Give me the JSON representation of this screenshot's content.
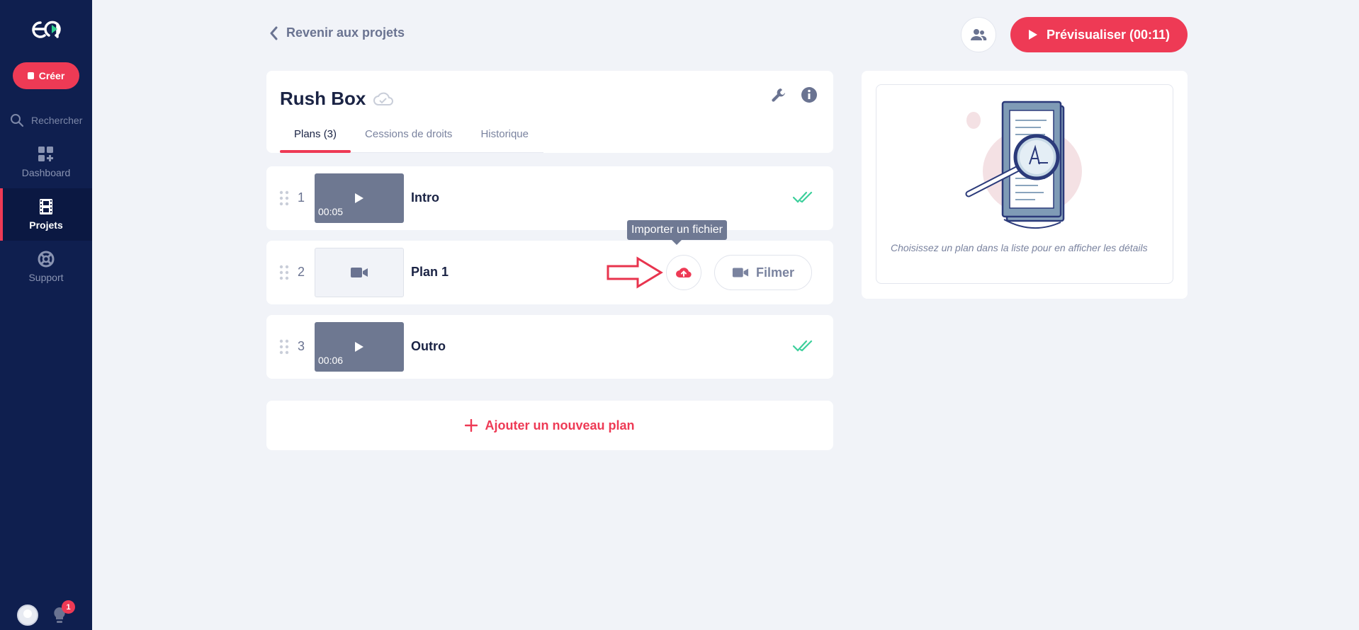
{
  "sidebar": {
    "create_label": "Créer",
    "search_label": "Rechercher",
    "items": [
      {
        "label": "Dashboard",
        "icon": "dashboard-icon"
      },
      {
        "label": "Projets",
        "icon": "film-icon",
        "active": true
      },
      {
        "label": "Support",
        "icon": "lifebuoy-icon"
      }
    ],
    "notification_count": "1"
  },
  "header": {
    "back_label": "Revenir aux projets",
    "preview_label": "Prévisualiser (00:11)"
  },
  "project": {
    "title": "Rush Box",
    "tabs": [
      {
        "label": "Plans (3)",
        "active": true
      },
      {
        "label": "Cessions de droits"
      },
      {
        "label": "Historique"
      }
    ]
  },
  "plans": [
    {
      "num": "1",
      "name": "Intro",
      "duration": "00:05",
      "done": true
    },
    {
      "num": "2",
      "name": "Plan 1",
      "film_label": "Filmer",
      "tooltip": "Importer un fichier"
    },
    {
      "num": "3",
      "name": "Outro",
      "duration": "00:06",
      "done": true
    }
  ],
  "add_plan_label": "Ajouter un nouveau plan",
  "detail": {
    "empty_text": "Choisissez un plan dans la liste pour en afficher les détails"
  },
  "colors": {
    "accent": "#ee3a55",
    "sidebar": "#0f1f4f",
    "success": "#3ccf9b"
  }
}
